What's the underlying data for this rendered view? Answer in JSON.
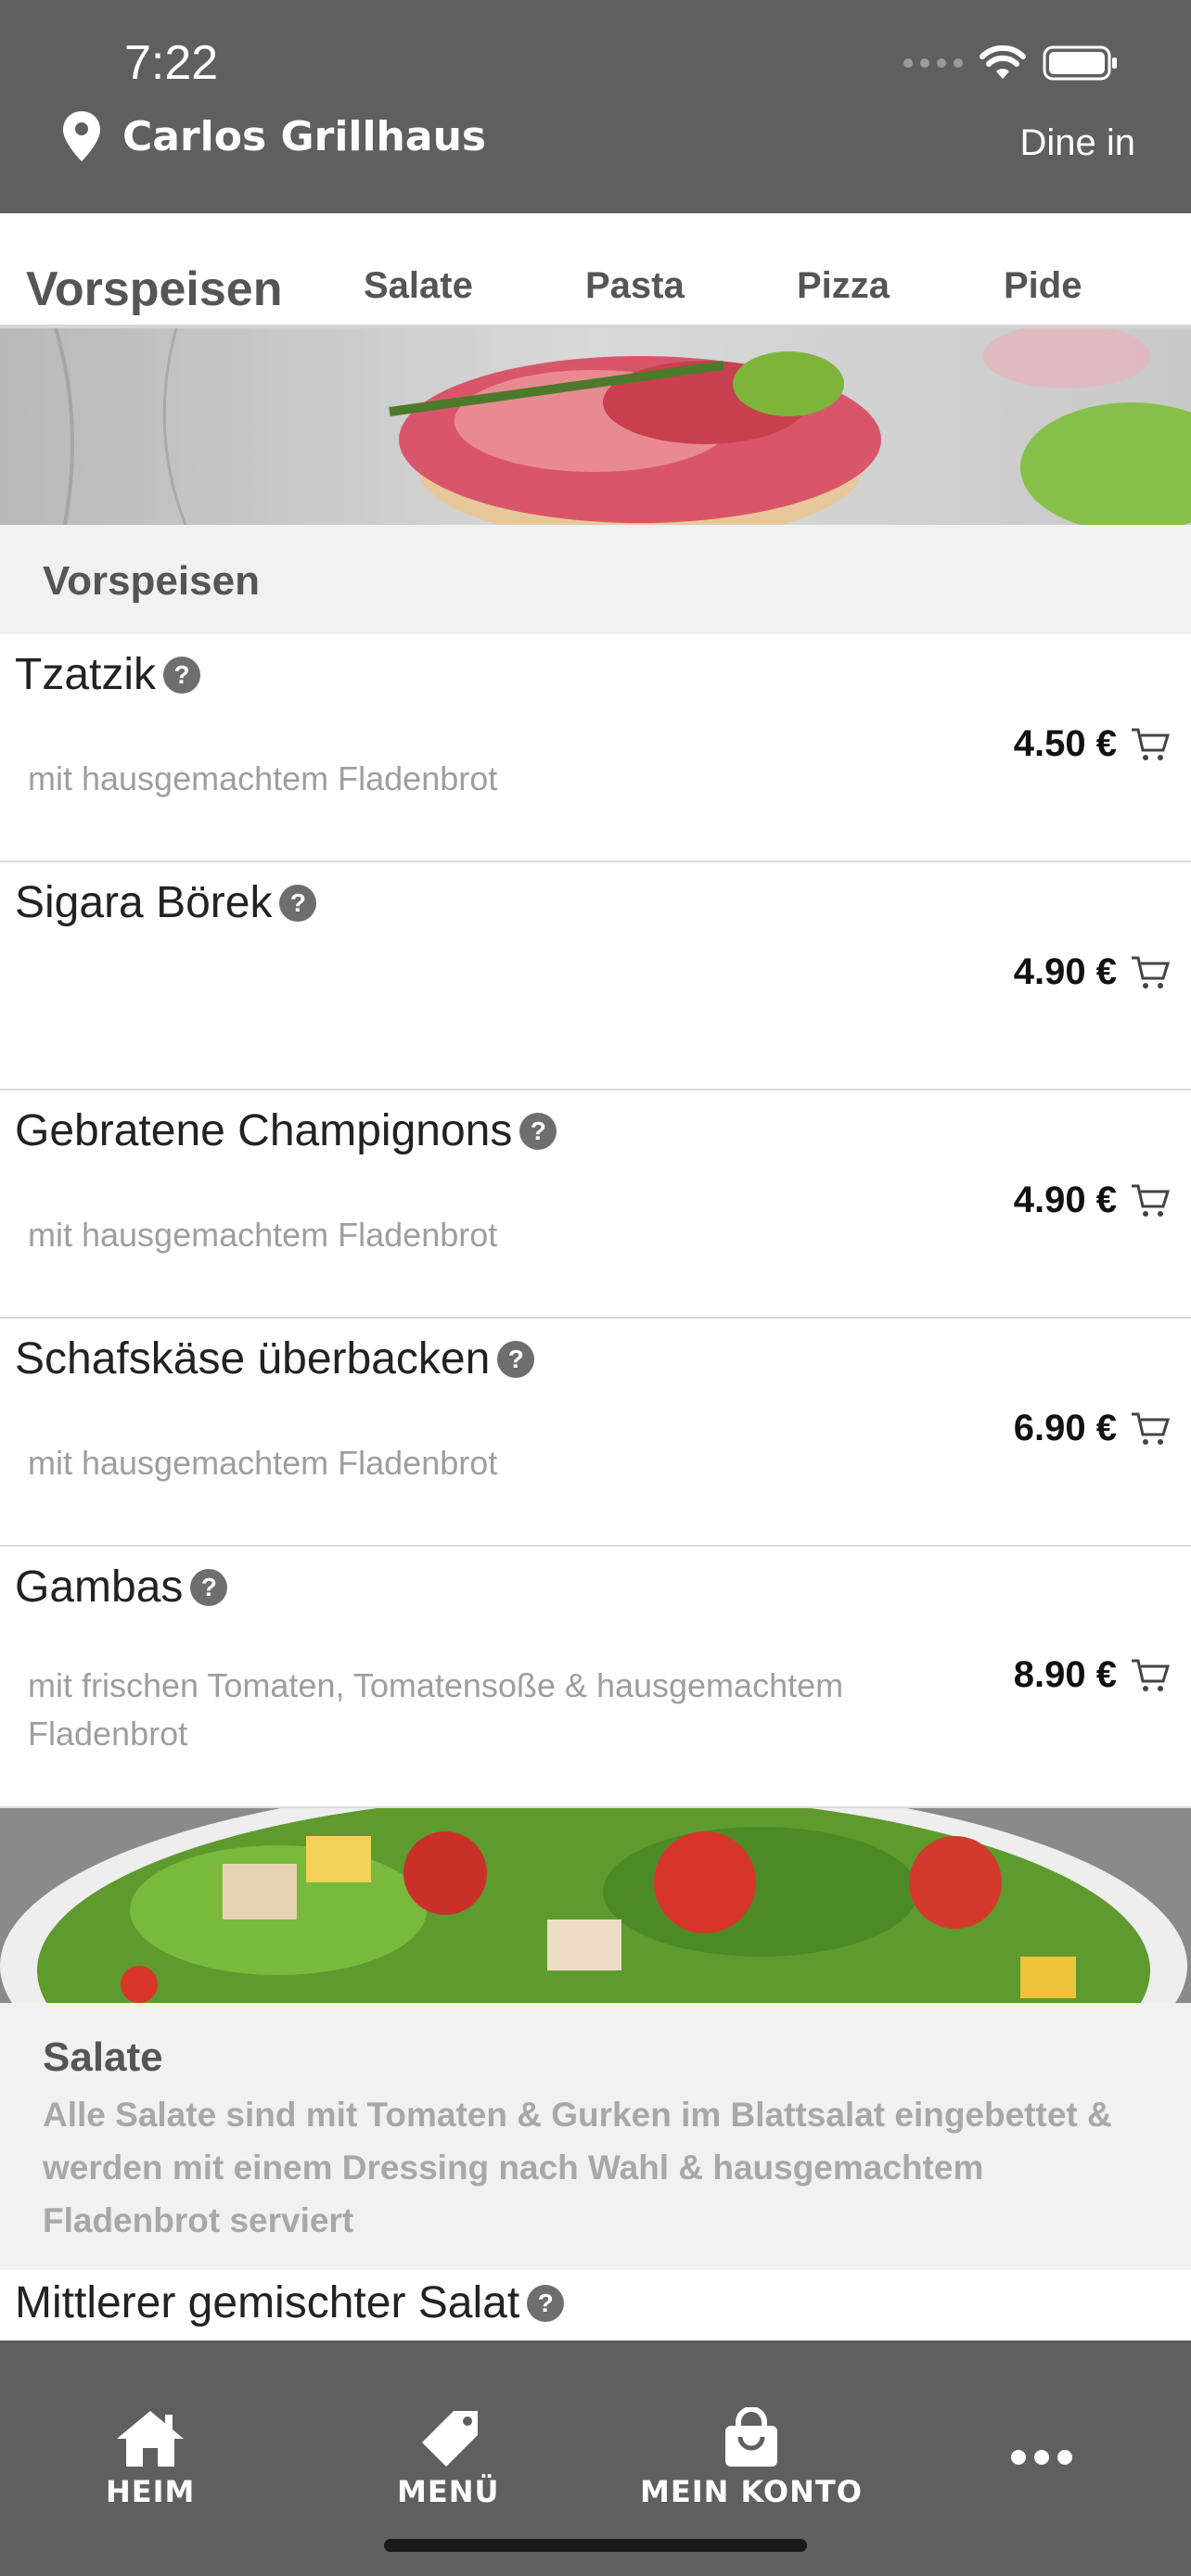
{
  "status": {
    "time": "7:22"
  },
  "header": {
    "store_name": "Carlos Grillhaus",
    "dine_mode": "Dine in"
  },
  "tabs": [
    "Vorspeisen",
    "Salate",
    "Pasta",
    "Pizza",
    "Pide"
  ],
  "sections": {
    "vorspeisen": {
      "title": "Vorspeisen",
      "items": [
        {
          "name": "Tzatzik",
          "description": "mit hausgemachtem Fladenbrot",
          "price": "4.50 €"
        },
        {
          "name": "Sigara Börek",
          "description": "",
          "price": "4.90 €"
        },
        {
          "name": "Gebratene Champignons",
          "description": "mit hausgemachtem Fladenbrot",
          "price": "4.90 €"
        },
        {
          "name": "Schafskäse überbacken",
          "description": "mit hausgemachtem Fladenbrot",
          "price": "6.90 €"
        },
        {
          "name": "Gambas",
          "description": "mit frischen Tomaten, Tomatensoße & hausgemachtem Fladenbrot",
          "price": "8.90 €"
        }
      ]
    },
    "salate": {
      "title": "Salate",
      "description": "Alle Salate sind mit Tomaten & Gurken im Blattsalat eingebettet & werden mit einem Dressing nach Wahl & hausgemachtem Fladenbrot serviert",
      "items": [
        {
          "name": "Mittlerer gemischter Salat"
        }
      ]
    }
  },
  "help_glyph": "?",
  "bottom_nav": [
    {
      "label": "HEIM",
      "icon": "home-icon"
    },
    {
      "label": "MENÜ",
      "icon": "tag-icon"
    },
    {
      "label": "MEIN KONTO",
      "icon": "shopping-bag-icon"
    },
    {
      "label": "",
      "icon": "more-icon"
    }
  ],
  "colors": {
    "header_bg": "#5f5f5f",
    "section_bg": "#f1f1f1",
    "muted_text": "#9e9e9e"
  }
}
